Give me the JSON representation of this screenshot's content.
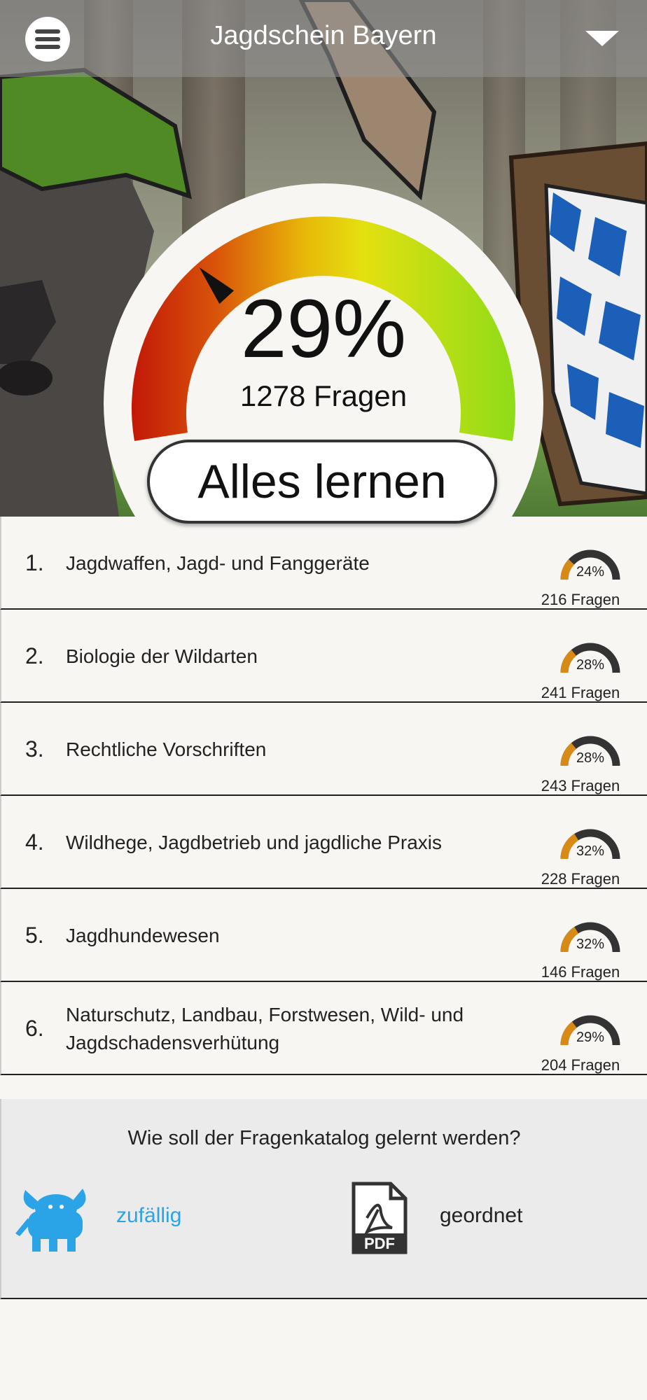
{
  "header": {
    "title": "Jagdschein Bayern"
  },
  "overall": {
    "percent": "29%",
    "questions": "1278 Fragen",
    "button": "Alles lernen",
    "progress": 0.29
  },
  "topics": [
    {
      "num": "1.",
      "title": "Jagdwaffen, Jagd- und Fanggeräte",
      "percent": "24%",
      "count": "216 Fragen",
      "progress": 0.24
    },
    {
      "num": "2.",
      "title": "Biologie der Wildarten",
      "percent": "28%",
      "count": "241 Fragen",
      "progress": 0.28
    },
    {
      "num": "3.",
      "title": "Rechtliche Vorschriften",
      "percent": "28%",
      "count": "243 Fragen",
      "progress": 0.28
    },
    {
      "num": "4.",
      "title": "Wildhege, Jagdbetrieb und jagdliche Praxis",
      "percent": "32%",
      "count": "228 Fragen",
      "progress": 0.32
    },
    {
      "num": "5.",
      "title": "Jagdhundewesen",
      "percent": "32%",
      "count": "146 Fragen",
      "progress": 0.32
    },
    {
      "num": "6.",
      "title": "Naturschutz, Landbau, Forstwesen, Wild- und Jagdschadensverhütung",
      "percent": "29%",
      "count": "204 Fragen",
      "progress": 0.29
    }
  ],
  "mode": {
    "question": "Wie soll der Fragenkatalog gelernt werden?",
    "options": [
      {
        "label": "zufällig",
        "icon": "bull-icon",
        "selected": true
      },
      {
        "label": "geordnet",
        "icon": "pdf-icon",
        "selected": false
      }
    ],
    "icon_labels": {
      "pdf": "PDF"
    }
  },
  "colors": {
    "accent": "#2aa4e6",
    "mini_fill": "#d88a16",
    "mini_track": "#333333"
  }
}
